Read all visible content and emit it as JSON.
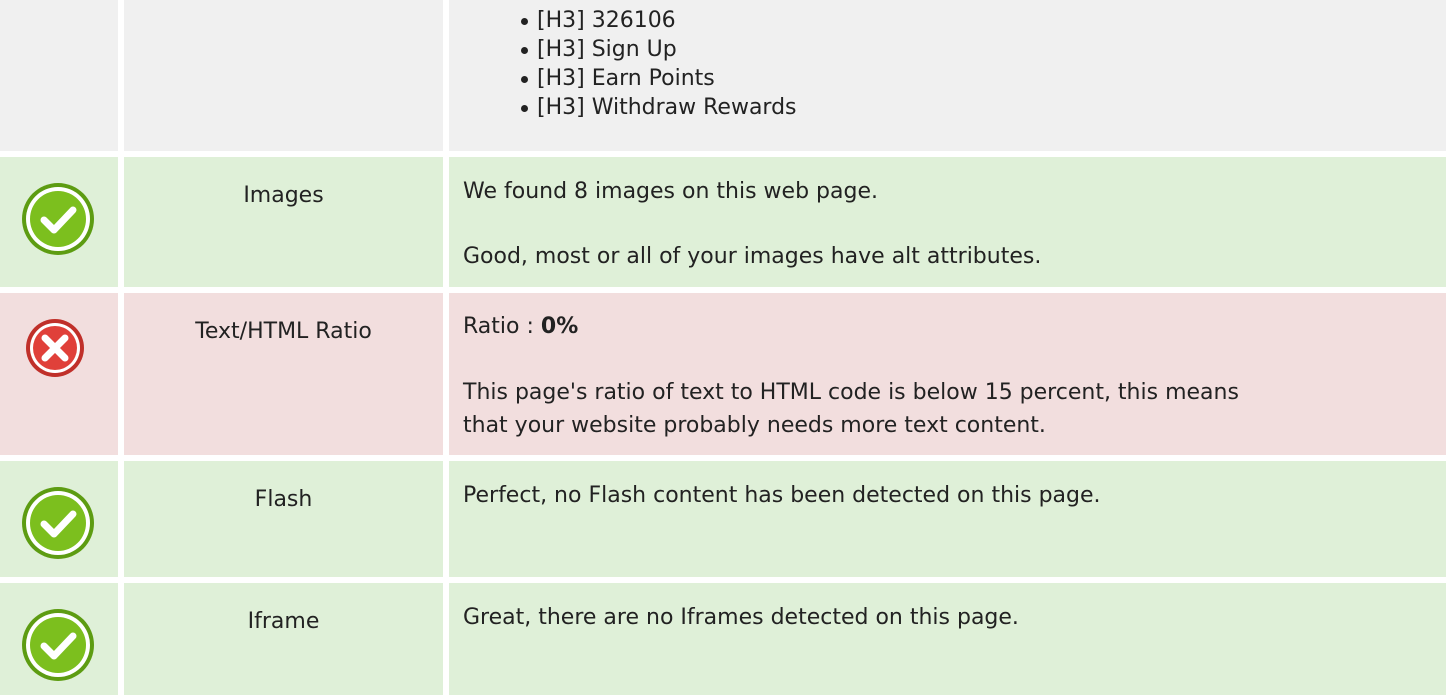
{
  "headings_list": {
    "items": [
      "[H3] 326106",
      "[H3] Sign Up",
      "[H3] Earn Points",
      "[H3] Withdraw Rewards"
    ]
  },
  "images_row": {
    "status": "pass",
    "icon": "check-circle-icon",
    "label": "Images",
    "line1": "We found 8 images on this web page.",
    "line2": "Good, most or all of your images have alt attributes."
  },
  "ratio_row": {
    "status": "fail",
    "icon": "cross-circle-icon",
    "label": "Text/HTML Ratio",
    "ratio_prefix": "Ratio : ",
    "ratio_value": "0%",
    "line2a": "This page's ratio of text to HTML code is below 15 percent, this means",
    "line2b": "that your website probably needs more text content."
  },
  "flash_row": {
    "status": "pass",
    "icon": "check-circle-icon",
    "label": "Flash",
    "line1": "Perfect, no Flash content has been detected on this page."
  },
  "iframe_row": {
    "status": "pass",
    "icon": "check-circle-icon",
    "label": "Iframe",
    "line1": "Great, there are no Iframes detected on this page."
  },
  "colors": {
    "pass_bg": "#dff0d8",
    "fail_bg": "#f2dede",
    "neutral_bg": "#f0f0f0",
    "check_green": "#7cbf1e",
    "cross_red": "#e0403a"
  }
}
